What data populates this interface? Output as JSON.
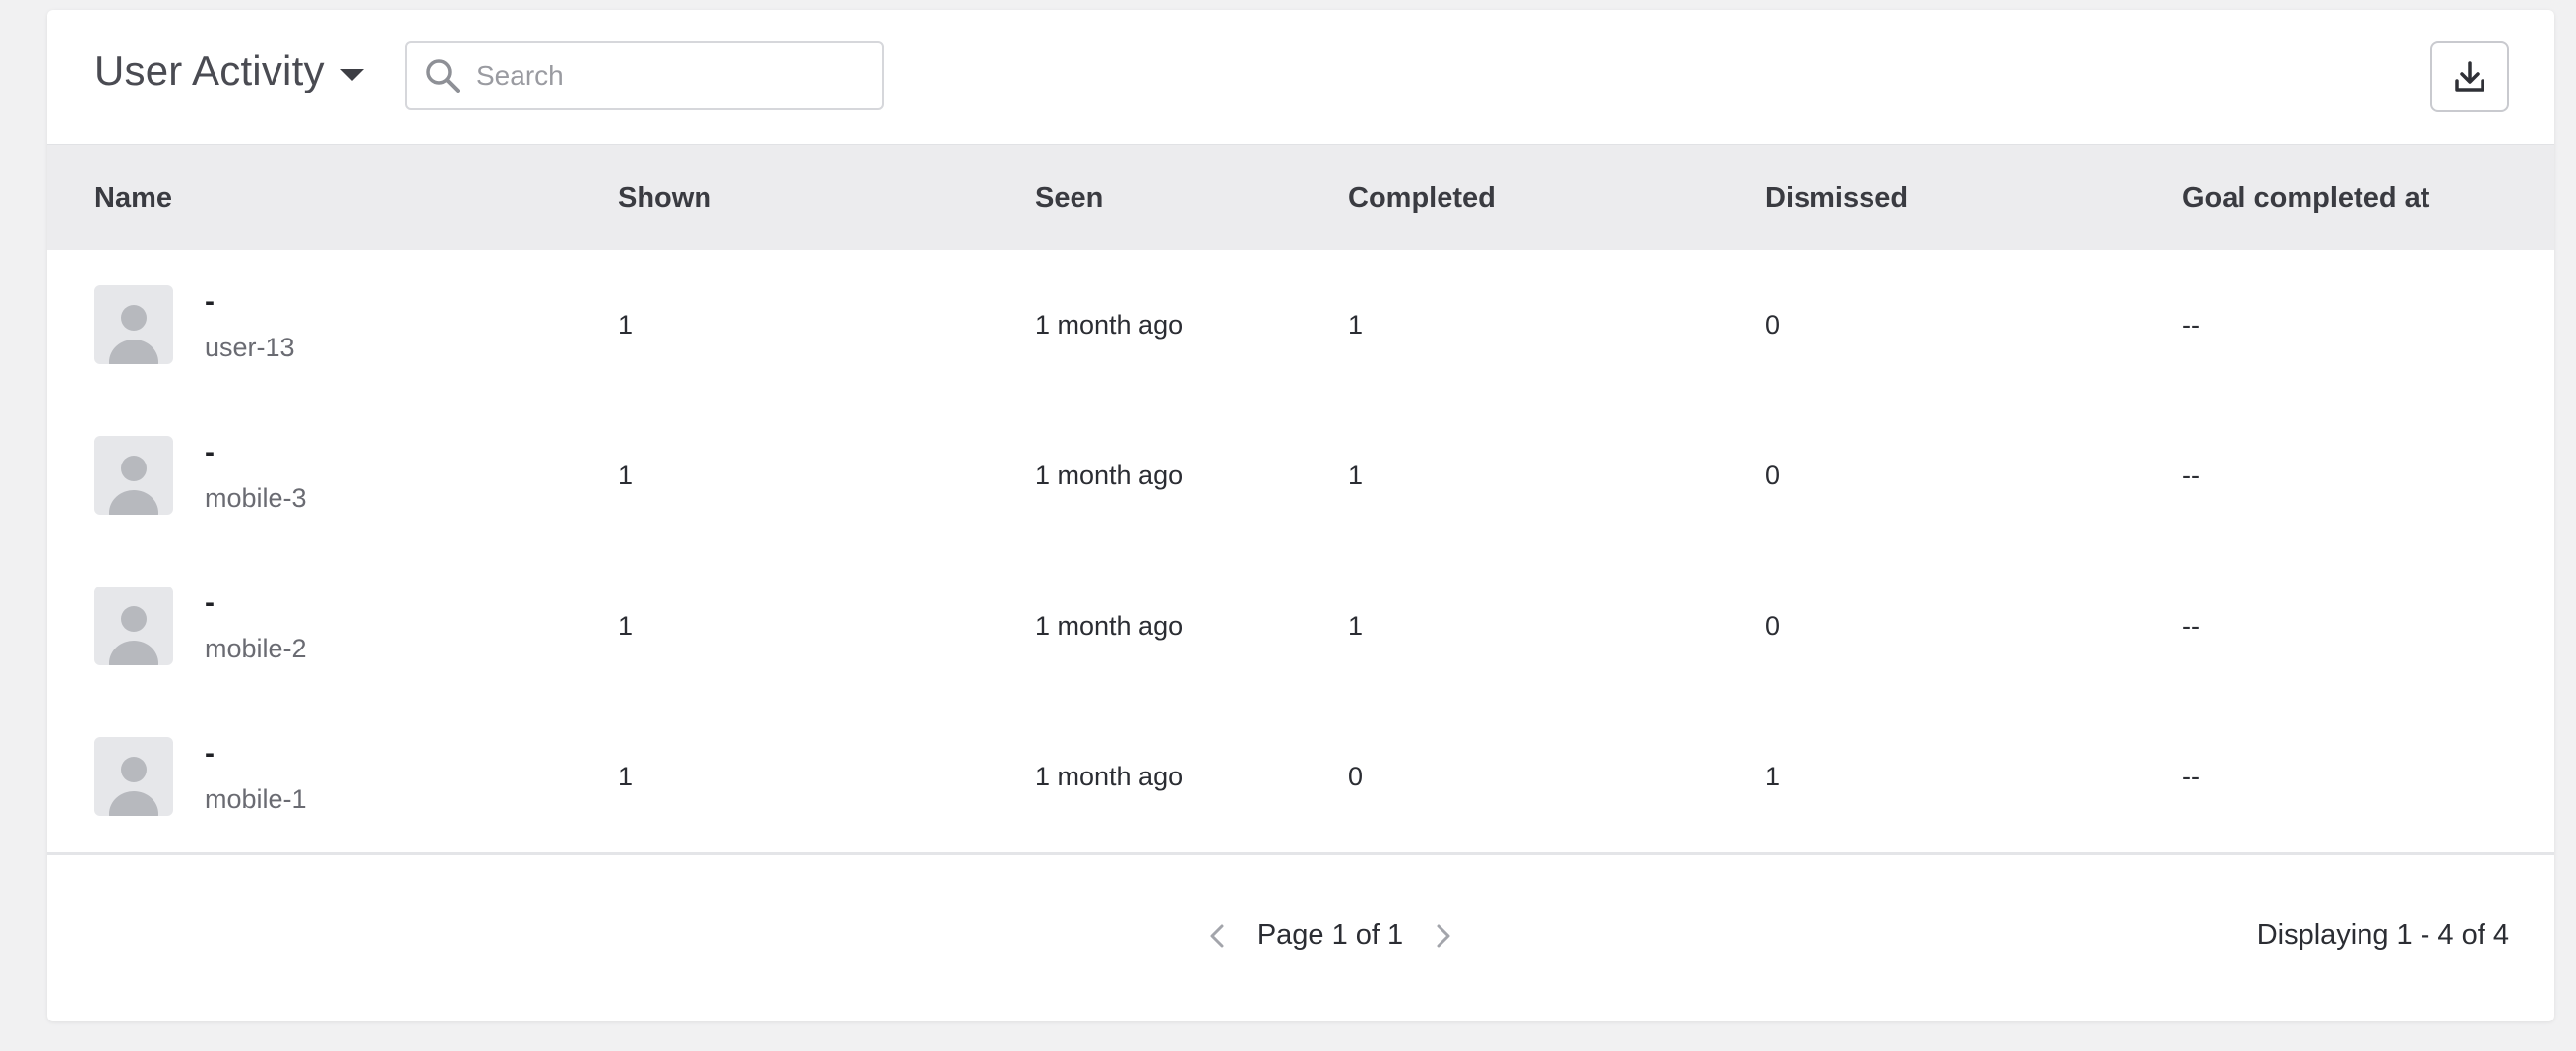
{
  "header": {
    "title": "User Activity",
    "search_placeholder": "Search",
    "search_value": ""
  },
  "columns": {
    "name": "Name",
    "shown": "Shown",
    "seen": "Seen",
    "completed": "Completed",
    "dismissed": "Dismissed",
    "goal": "Goal completed at"
  },
  "rows": [
    {
      "name": "-",
      "user_id": "user-13",
      "shown": "1",
      "seen": "1 month ago",
      "completed": "1",
      "dismissed": "0",
      "goal": "--"
    },
    {
      "name": "-",
      "user_id": "mobile-3",
      "shown": "1",
      "seen": "1 month ago",
      "completed": "1",
      "dismissed": "0",
      "goal": "--"
    },
    {
      "name": "-",
      "user_id": "mobile-2",
      "shown": "1",
      "seen": "1 month ago",
      "completed": "1",
      "dismissed": "0",
      "goal": "--"
    },
    {
      "name": "-",
      "user_id": "mobile-1",
      "shown": "1",
      "seen": "1 month ago",
      "completed": "0",
      "dismissed": "1",
      "goal": "--"
    }
  ],
  "pagination": {
    "page_label": "Page 1 of 1",
    "display_count": "Displaying 1 - 4 of 4"
  },
  "icons": {
    "search": "search-icon",
    "dropdown": "caret-down-icon",
    "download": "download-icon",
    "avatar": "user-avatar-icon",
    "prev": "chevron-left-icon",
    "next": "chevron-right-icon"
  },
  "colors": {
    "background": "#f1f1f2",
    "header_row": "#ececee",
    "avatar_bg": "#e6e7ea",
    "avatar_fg": "#b7b9be"
  }
}
